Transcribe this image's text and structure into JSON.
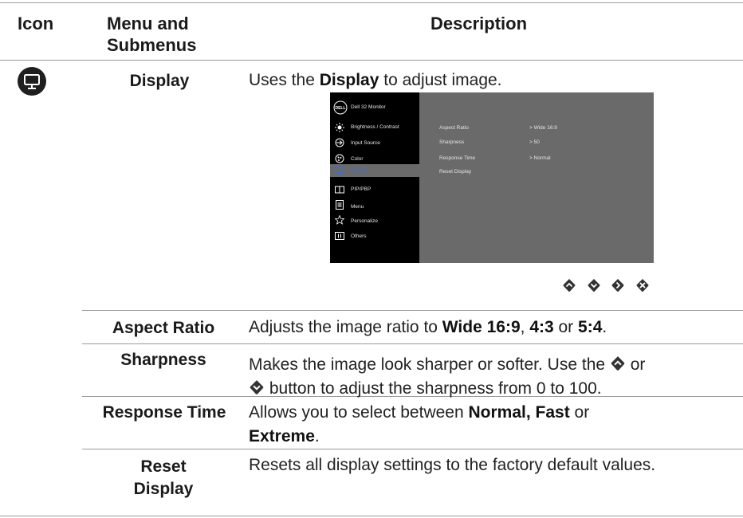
{
  "header": {
    "icon": "Icon",
    "menu_line1": "Menu and",
    "menu_line2": "Submenus",
    "description": "Description"
  },
  "display_row": {
    "icon": "monitor-icon",
    "name": "Display",
    "desc_pre": "Uses the ",
    "desc_bold": "Display",
    "desc_post": " to adjust image."
  },
  "osd": {
    "brand": "DELL",
    "title": "Dell 32 Monitor",
    "menu": [
      {
        "label": "Brightness / Contrast",
        "icon": "brightness-icon"
      },
      {
        "label": "Input Source",
        "icon": "input-source-icon"
      },
      {
        "label": "Color",
        "icon": "color-icon"
      },
      {
        "label": "Display",
        "icon": "monitor-icon",
        "selected": true
      },
      {
        "label": "PIP/PBP",
        "icon": "pip-icon"
      },
      {
        "label": "Menu",
        "icon": "menu-icon"
      },
      {
        "label": "Personalize",
        "icon": "star-icon"
      },
      {
        "label": "Others",
        "icon": "others-icon"
      }
    ],
    "settings": [
      {
        "label": "Aspect Ratio",
        "value": "> Wide 16:9"
      },
      {
        "label": "Sharpness",
        "value": "> 50"
      },
      {
        "label": "Response Time",
        "value": "> Normal"
      },
      {
        "label": "Reset Display",
        "value": ""
      }
    ],
    "nav_buttons": [
      "up-icon",
      "down-icon",
      "right-icon",
      "close-icon"
    ]
  },
  "rows": {
    "aspect": {
      "name": "Aspect Ratio",
      "t1": "Adjusts the image ratio to ",
      "b1": "Wide 16:9",
      "t2": ", ",
      "b2": "4:3",
      "t3": " or ",
      "b3": "5:4",
      "t4": "."
    },
    "sharpness": {
      "name": "Sharpness",
      "line1": "Makes the image look sharper or softer. Use the",
      "line1_end": "or",
      "line2": "button to adjust the sharpness from 0 to 100."
    },
    "response": {
      "name": "Response Time",
      "t1": "Allows you to select between ",
      "b1": "Normal, Fast",
      "t2": " or",
      "b2": "Extreme",
      "t3": "."
    },
    "reset": {
      "name_line1": "Reset",
      "name_line2": "Display",
      "desc": "Resets all display settings to the factory default values."
    }
  },
  "colors": {
    "text": "#1a1a1a",
    "rule": "#9a9a9a",
    "osd_panel": "#6a6a6a",
    "button": "#333333"
  }
}
